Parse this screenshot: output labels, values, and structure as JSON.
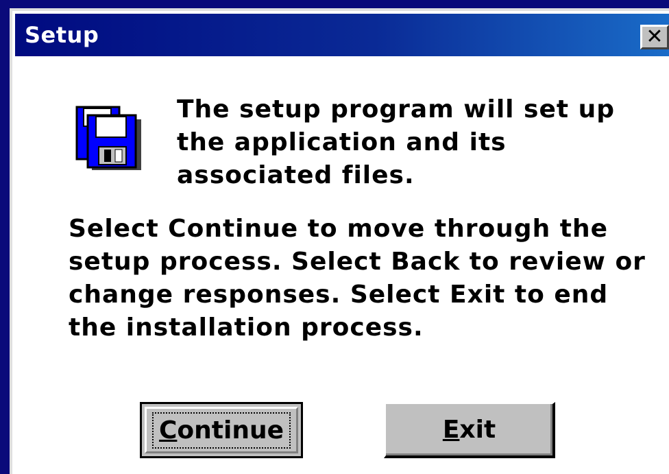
{
  "window": {
    "title": "Setup",
    "close_glyph": "✕"
  },
  "icon": "floppy-disk-icon",
  "intro_text": "The setup program will set up\nthe application and its\nassociated files.",
  "instructions_text": "Select Continue to move through the\nsetup process. Select Back to review or\nchange responses. Select Exit to end\nthe installation process.",
  "buttons": {
    "continue": {
      "mnemonic": "C",
      "rest": "ontinue"
    },
    "exit": {
      "mnemonic": "E",
      "rest": "xit"
    }
  },
  "colors": {
    "title_start": "#000a80",
    "title_end": "#1a6cc8",
    "button_face": "#c0c0c0",
    "icon_blue": "#0000ff"
  }
}
